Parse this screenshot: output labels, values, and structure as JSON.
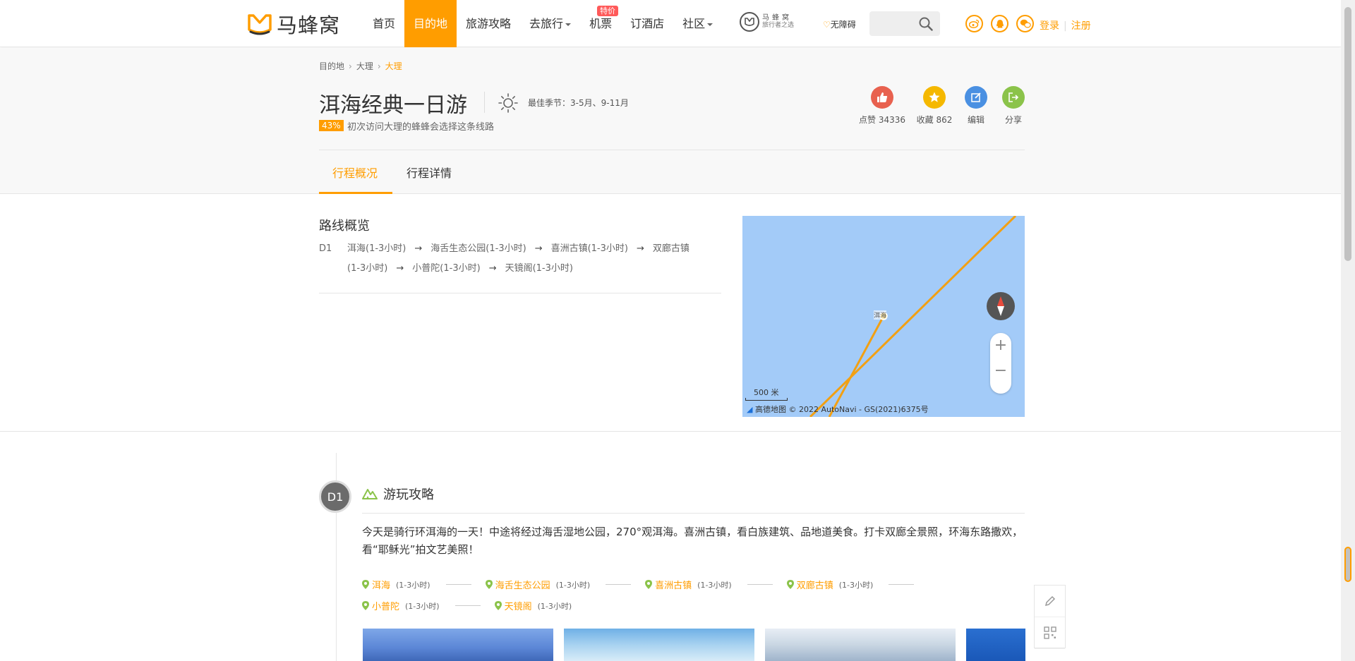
{
  "header": {
    "logo_text": "马蜂窝",
    "nav": [
      {
        "label": "首页",
        "active": false
      },
      {
        "label": "目的地",
        "active": true
      },
      {
        "label": "旅游攻略",
        "active": false
      },
      {
        "label": "去旅行",
        "active": false,
        "dropdown": true
      },
      {
        "label": "机票",
        "active": false,
        "badge": "特价"
      },
      {
        "label": "订酒店",
        "active": false
      },
      {
        "label": "社区",
        "active": false,
        "dropdown": true
      }
    ],
    "mini_logo_line1": "马蜂窝",
    "mini_logo_line2": "旅行者之选",
    "accessibility": "无障碍",
    "login": "登录",
    "register": "注册",
    "brand_color": "#ff9d00"
  },
  "breadcrumb": [
    "目的地",
    "大理",
    "大理"
  ],
  "route_title": "洱海经典一日游",
  "best_season": "最佳季节：3-5月、9-11月",
  "first_visit": {
    "percent": "43%",
    "text": "初次访问大理的蜂蜂会选择这条线路"
  },
  "actions": [
    {
      "label": "点赞 34336",
      "icon": "thumb-up-icon",
      "color": "#e8614f"
    },
    {
      "label": "收藏 862",
      "icon": "star-icon",
      "color": "#f5b800"
    },
    {
      "label": "编辑",
      "icon": "edit-icon",
      "color": "#4a90e2"
    },
    {
      "label": "分享",
      "icon": "share-icon",
      "color": "#8bc34a"
    }
  ],
  "tabs": [
    "行程概况",
    "行程详情"
  ],
  "overview": {
    "title": "路线概览",
    "day": "D1",
    "stops_line1": [
      "洱海(1-3小时)",
      "海舌生态公园(1-3小时)",
      "喜洲古镇(1-3小时)",
      "双廊古镇"
    ],
    "stops_line2": [
      "(1-3小时)",
      "小普陀(1-3小时)",
      "天镜阁(1-3小时)"
    ],
    "arrow": "→"
  },
  "map": {
    "scale": "500 米",
    "copyright": "高德地图 © 2022 AutoNavi - GS(2021)6375号",
    "marker": "洱海",
    "zoom_in": "+",
    "zoom_out": "−"
  },
  "day": {
    "badge": "D1",
    "section_title": "游玩攻略",
    "description": "今天是骑行环洱海的一天！中途将经过海舌湿地公园，270°观洱海。喜洲古镇，看白族建筑、品地道美食。打卡双廊全景照，环海东路撒欢，看“耶稣光”拍文艺美照！",
    "stops": [
      {
        "name": "洱海",
        "duration": "(1-3小时)"
      },
      {
        "name": "海舌生态公园",
        "duration": "(1-3小时)"
      },
      {
        "name": "喜洲古镇",
        "duration": "(1-3小时)"
      },
      {
        "name": "双廊古镇",
        "duration": "(1-3小时)"
      },
      {
        "name": "小普陀",
        "duration": "(1-3小时)"
      },
      {
        "name": "天镜阁",
        "duration": "(1-3小时)"
      }
    ]
  }
}
